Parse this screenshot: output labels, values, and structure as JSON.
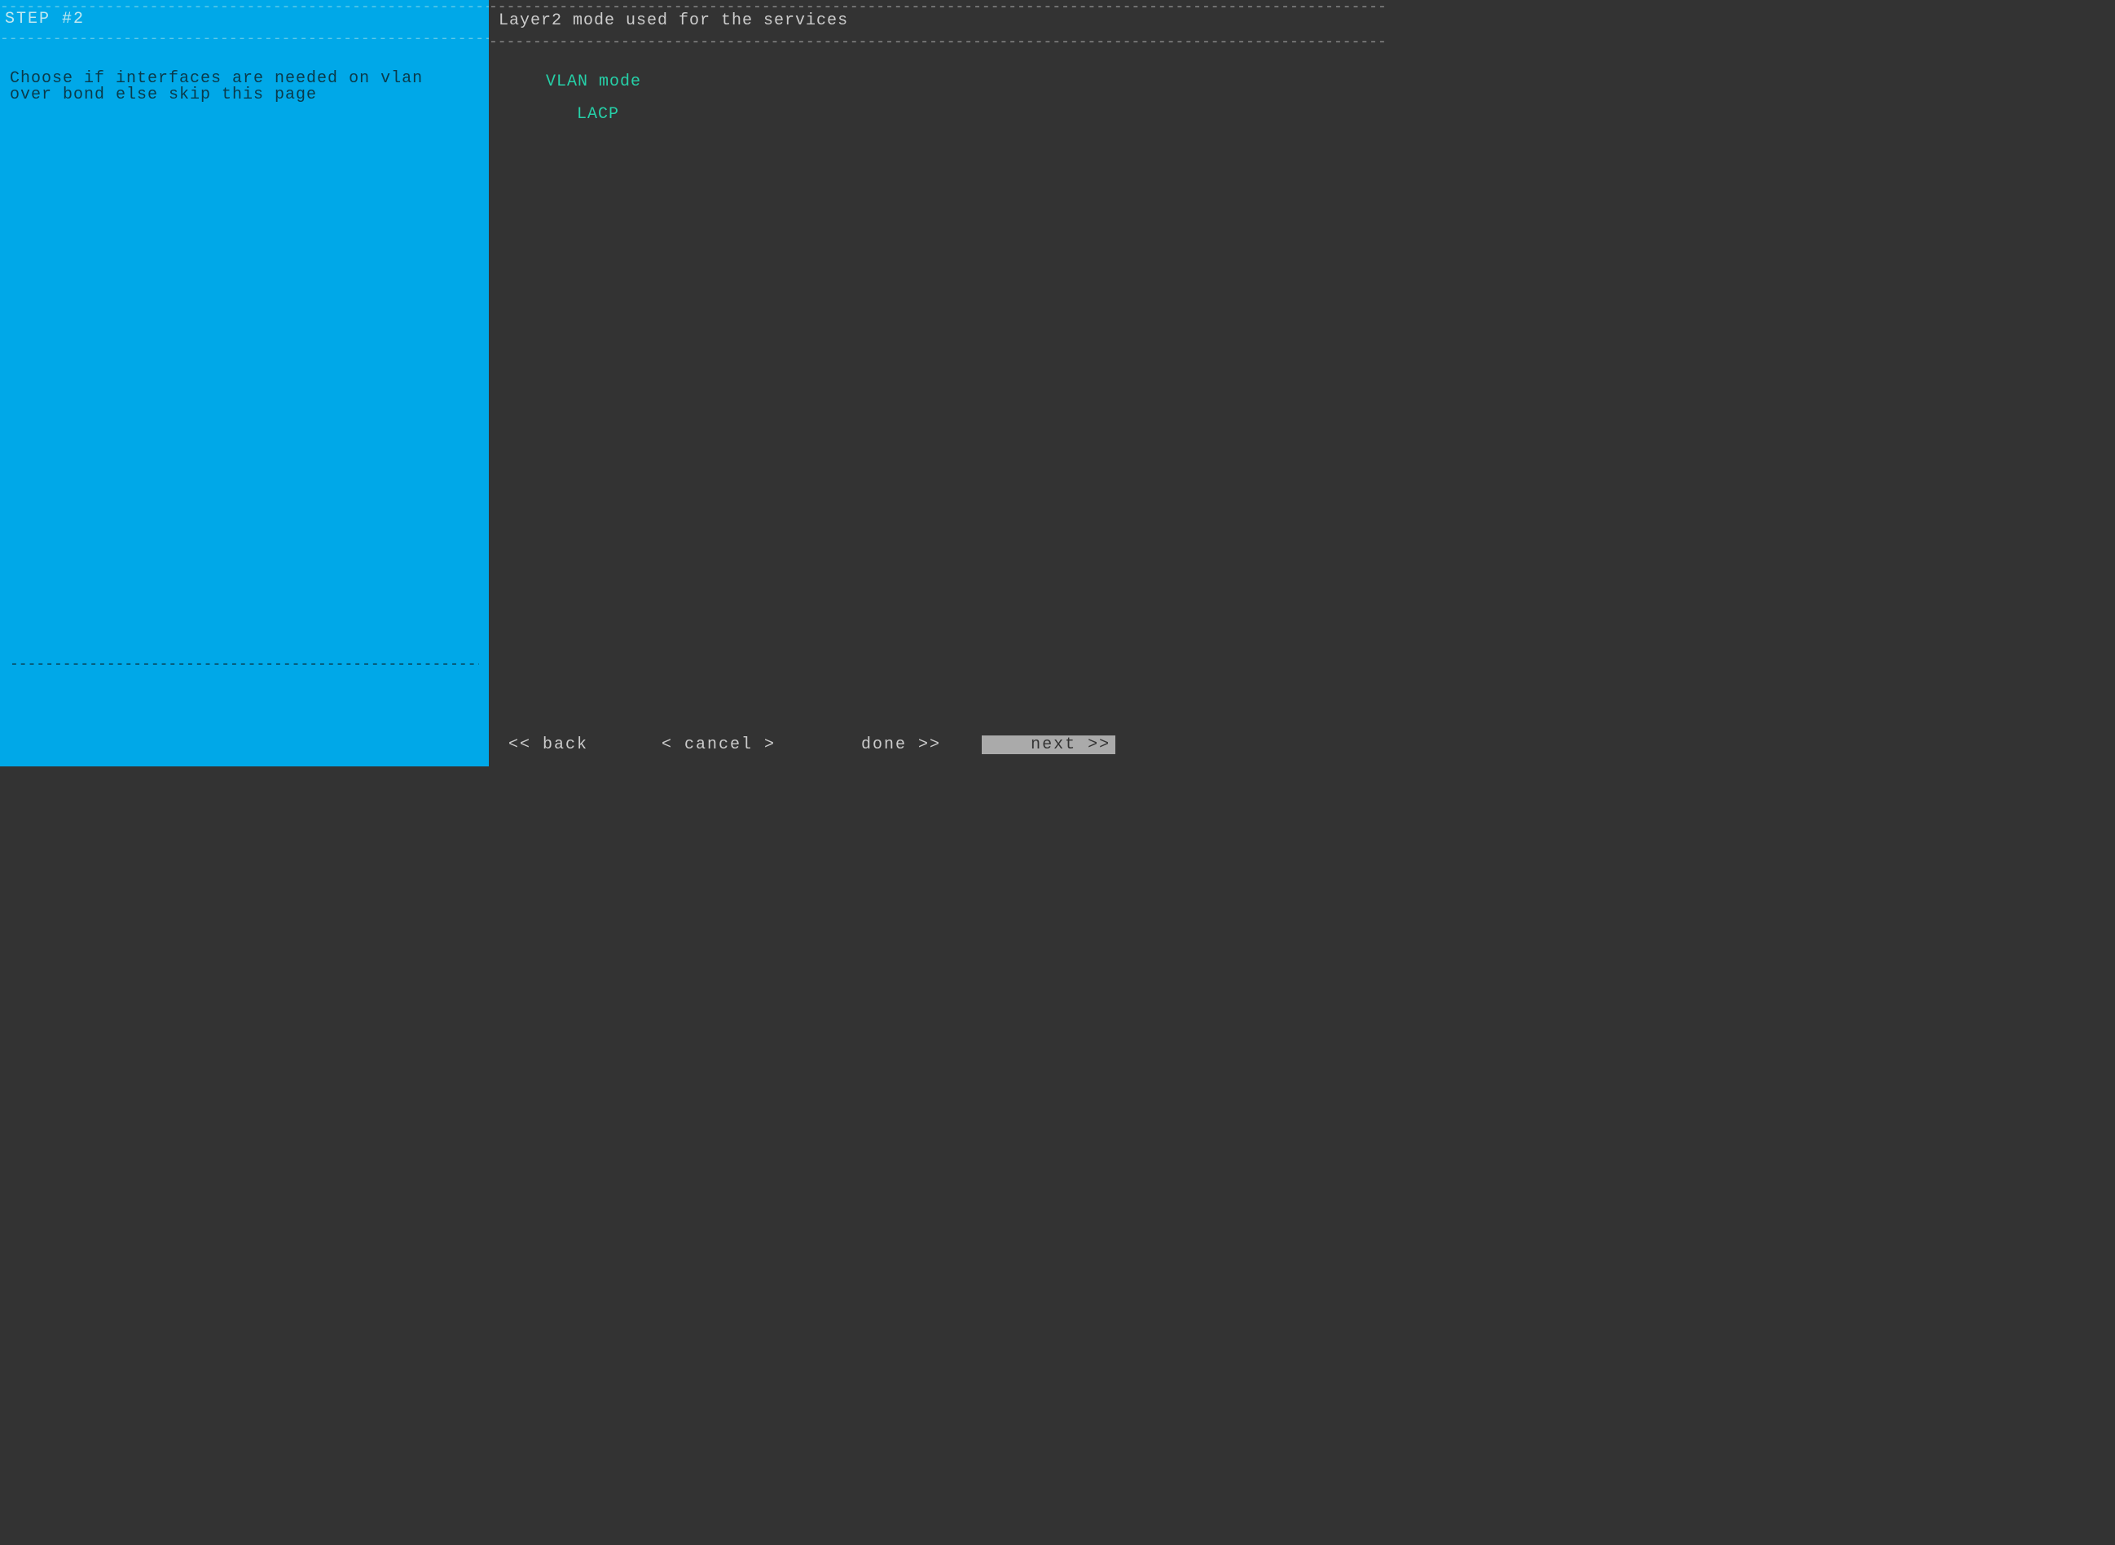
{
  "left": {
    "title": "STEP #2",
    "description": "Choose if interfaces are needed on vlan over bond else skip this page"
  },
  "right": {
    "title": "Layer2 mode used for the services",
    "options": [
      "VLAN mode",
      "LACP"
    ]
  },
  "footer": {
    "back": "<< back",
    "cancel": "< cancel >",
    "done": "done >>",
    "next": "next >>"
  }
}
